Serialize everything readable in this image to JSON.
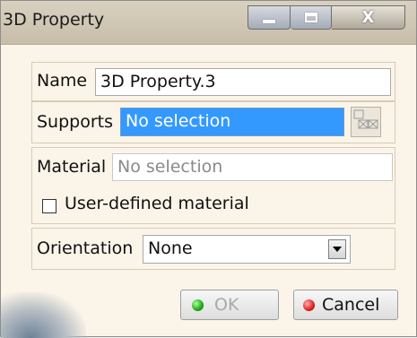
{
  "window": {
    "title": "3D Property",
    "controls": {
      "minimize_icon": "minimize-icon",
      "maximize_icon": "maximize-icon",
      "close_icon": "close-icon",
      "close_glyph": "X"
    }
  },
  "name_section": {
    "label": "Name",
    "value": "3D Property.3"
  },
  "supports_section": {
    "label": "Supports",
    "value": "No selection",
    "icon": "selection-list-icon"
  },
  "material_section": {
    "label": "Material",
    "value": "No selection",
    "checkbox_label": "User-defined material",
    "checkbox_checked": false
  },
  "orientation_section": {
    "label": "Orientation",
    "selected": "None"
  },
  "buttons": {
    "ok": "OK",
    "cancel": "Cancel"
  },
  "colors": {
    "selection": "#3399ff",
    "ok_icon": "#1ea812",
    "cancel_icon": "#e21f1f",
    "dialog_bg": "#fbf4e8"
  }
}
